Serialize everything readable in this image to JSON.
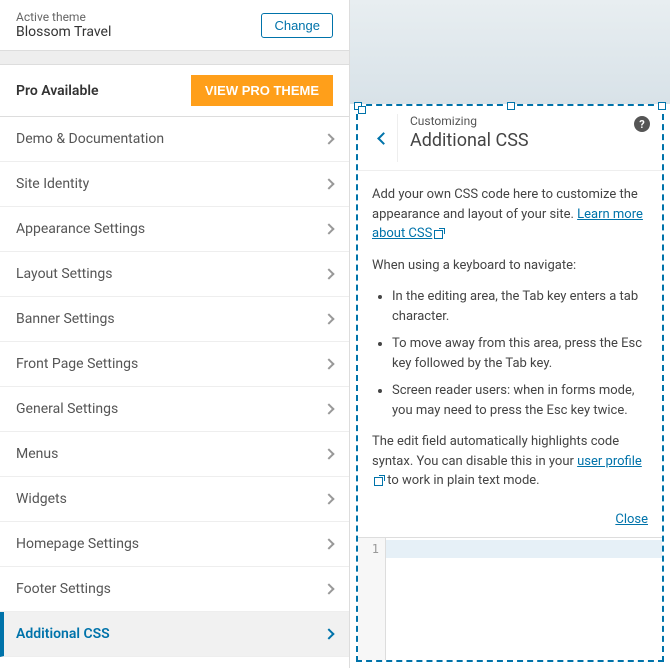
{
  "theme": {
    "label": "Active theme",
    "name": "Blossom Travel",
    "change": "Change"
  },
  "pro": {
    "label": "Pro Available",
    "button": "VIEW PRO THEME"
  },
  "menu": [
    "Demo & Documentation",
    "Site Identity",
    "Appearance Settings",
    "Layout Settings",
    "Banner Settings",
    "Front Page Settings",
    "General Settings",
    "Menus",
    "Widgets",
    "Homepage Settings",
    "Footer Settings",
    "Additional CSS"
  ],
  "panel": {
    "customizing": "Customizing",
    "title": "Additional CSS",
    "intro1": "Add your own CSS code here to customize the appearance and layout of your site. ",
    "learn_link": "Learn more about CSS",
    "kb_heading": "When using a keyboard to navigate:",
    "bullets": [
      "In the editing area, the Tab key enters a tab character.",
      "To move away from this area, press the Esc key followed by the Tab key.",
      "Screen reader users: when in forms mode, you may need to press the Esc key twice."
    ],
    "syntax1": "The edit field automatically highlights code syntax. You can disable this in your ",
    "profile_link": "user profile",
    "syntax2": " to work in plain text mode.",
    "close": "Close",
    "line_no": "1"
  }
}
